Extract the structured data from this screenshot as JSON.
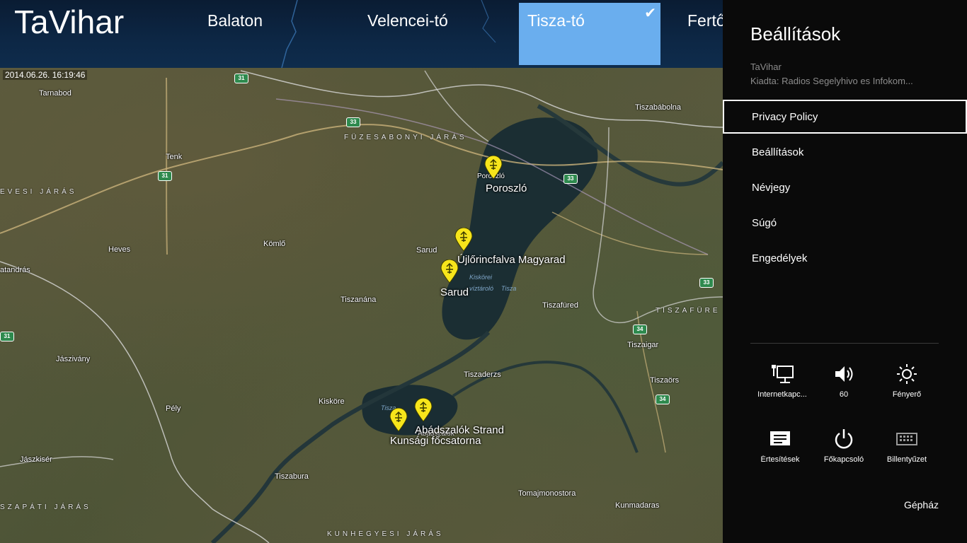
{
  "app": {
    "title": "TaVihar",
    "timestamp": "2014.06.26. 16:19:46"
  },
  "tabs": [
    {
      "label": "Balaton",
      "selected": false
    },
    {
      "label": "Velencei-tó",
      "selected": false
    },
    {
      "label": "Tisza-tó",
      "selected": true
    },
    {
      "label": "Fertő",
      "selected": false
    }
  ],
  "map": {
    "towns": [
      "Tarnabod",
      "Tenk",
      "Heves",
      "Kömlő",
      "Sarud",
      "Tiszanána",
      "Jászivány",
      "Pély",
      "Kisköre",
      "Tiszabura",
      "Jászkisér",
      "Tiszabábolna",
      "Tiszafüred",
      "Tiszaigar",
      "Tiszaderzs",
      "Tiszaörs",
      "Tomajmonostora",
      "Kunmadaras",
      "Abádszalók",
      "Poroszló",
      "atandrás"
    ],
    "districts": [
      "FÜZESABONYI JÁRÁS",
      "EVESI JÁRÁS",
      "TISZAFÜRE",
      "SZAPÁTI JÁRÁS",
      "KUNHEGYESI JÁRÁS"
    ],
    "roads": [
      "31",
      "33",
      "31",
      "31",
      "33",
      "33",
      "34",
      "34"
    ],
    "water_labels": [
      "Kiskörei",
      "víztároló",
      "Tisza",
      "Tisza"
    ],
    "stations": [
      {
        "name": "Poroszló"
      },
      {
        "name": "Újlőrincfalva Magyarad"
      },
      {
        "name": "Sarud"
      },
      {
        "name": "Abádszalók Strand"
      },
      {
        "name": "Kunsági főcsatorna"
      }
    ],
    "pin_color": "#f7e51b"
  },
  "settings": {
    "title": "Beállítások",
    "app_name": "TaVihar",
    "publisher": "Kiadta: Radios Segelyhivo es Infokom...",
    "items": [
      "Privacy Policy",
      "Beállítások",
      "Névjegy",
      "Súgó",
      "Engedélyek"
    ],
    "quick_settings": [
      {
        "icon": "network-icon",
        "label": "Internetkapc..."
      },
      {
        "icon": "volume-icon",
        "label": "60"
      },
      {
        "icon": "brightness-icon",
        "label": "Fényerő"
      },
      {
        "icon": "notifications-icon",
        "label": "Értesítések"
      },
      {
        "icon": "power-icon",
        "label": "Főkapcsoló"
      },
      {
        "icon": "keyboard-icon",
        "label": "Billentyűzet"
      }
    ],
    "change_pc_settings": "Gépház",
    "accent_color": "#6aaeee"
  }
}
